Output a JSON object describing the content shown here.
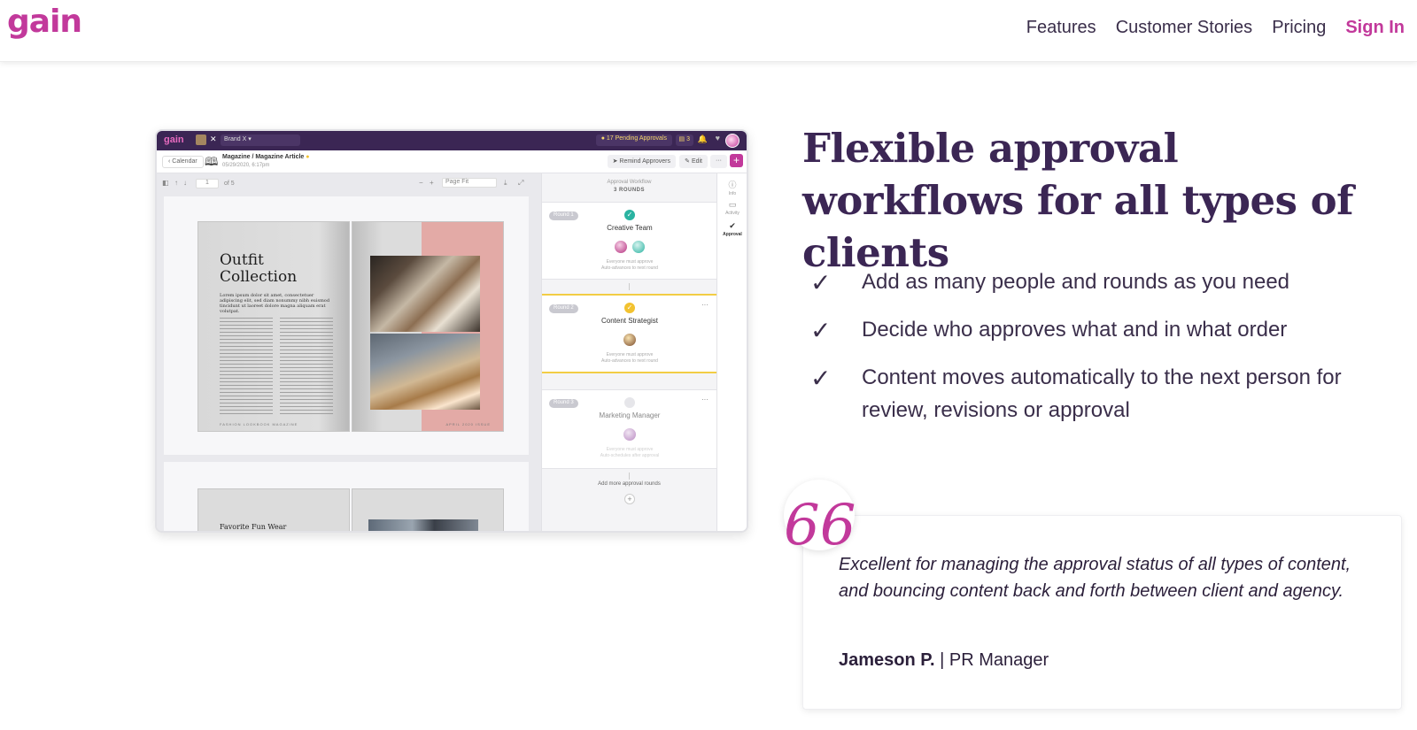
{
  "nav": {
    "logo": "gain",
    "links": [
      "Features",
      "Customer Stories",
      "Pricing"
    ],
    "signin": "Sign In"
  },
  "app": {
    "logo": "gain",
    "brand": "Brand X",
    "pending": "17 Pending Approvals",
    "count": "3",
    "back": "Calendar",
    "doc_title": "Magazine / Magazine Article",
    "doc_date": "05/29/2020, 6:17pm",
    "btn_remind": "Remind Approvers",
    "btn_edit": "Edit",
    "btn_more": "···",
    "viewer": {
      "page": "1",
      "of": "of 5",
      "fit": "Page Fit",
      "mag_title_1": "Outfit",
      "mag_title_2": "Collection",
      "mag_intro": "Lorem ipsum dolor sit amet, consectetuer adipiscing elit, sed diam nonummy nibh euismod tincidunt ut laoreet dolore magna aliquam erat volutpat.",
      "mag_foot": "FASHION LOOKBOOK MAGAZINE",
      "right_foot": "APRIL 2020 ISSUE",
      "page2_title": "Favorite Fun Wear"
    },
    "workflow": {
      "label": "Approval Workflow",
      "rounds_count": "3 ROUNDS",
      "rounds": [
        {
          "badge": "Round 1",
          "name": "Creative Team",
          "note1": "Everyone must approve",
          "note2": "Auto-advances to next round"
        },
        {
          "badge": "Round 2",
          "name": "Content Strategist",
          "note1": "Everyone must approve",
          "note2": "Auto-advances to next round"
        },
        {
          "badge": "Round 3",
          "name": "Marketing Manager",
          "note1": "Everyone must approve",
          "note2": "Auto-schedules after approval"
        }
      ],
      "add_more": "Add more approval rounds"
    },
    "rail": {
      "info": "Info",
      "activity": "Activity",
      "approval": "Approval"
    }
  },
  "headline": "Flexible approval workflows for all types of clients",
  "features": [
    "Add as many people and rounds as you need",
    "Decide who approves what and in what order",
    "Content moves automatically to the next person for review, revisions or approval"
  ],
  "quote": {
    "mark": "66",
    "text": "Excellent for managing the approval status of all types of content, and bouncing content back and forth between client and agency.",
    "author": "Jameson P.",
    "role": " | PR Manager"
  },
  "colors": {
    "brand": "#c2399b",
    "dark_purple": "#3b2654",
    "highlight": "#f2cd45"
  }
}
